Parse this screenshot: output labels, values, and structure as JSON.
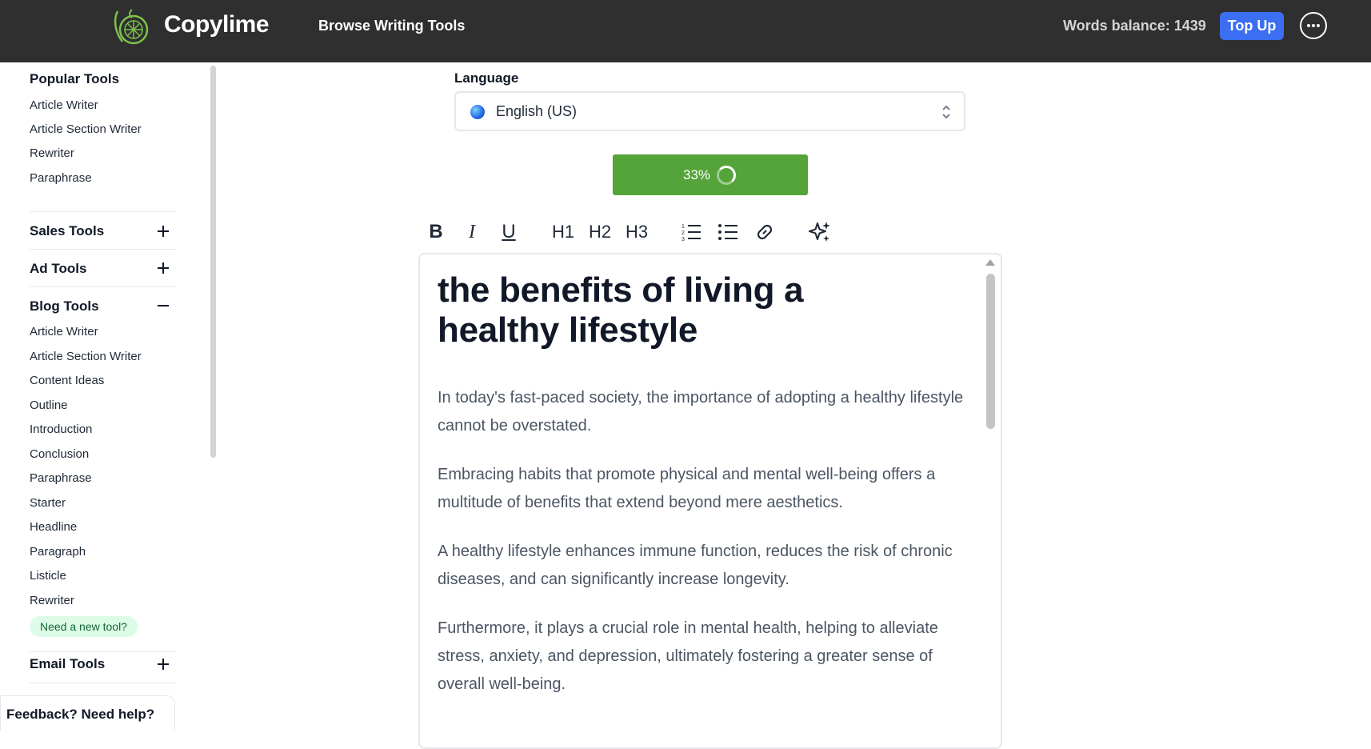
{
  "header": {
    "brand": "Copylime",
    "browse_label": "Browse Writing Tools",
    "balance_label": "Words balance: 1439",
    "topup_label": "Top Up"
  },
  "sidebar": {
    "popular": {
      "title": "Popular Tools",
      "items": [
        "Article Writer",
        "Article Section Writer",
        "Rewriter",
        "Paraphrase"
      ]
    },
    "sales_title": "Sales Tools",
    "ad_title": "Ad Tools",
    "blog": {
      "title": "Blog Tools",
      "items": [
        "Article Writer",
        "Article Section Writer",
        "Content Ideas",
        "Outline",
        "Introduction",
        "Conclusion",
        "Paraphrase",
        "Starter",
        "Headline",
        "Paragraph",
        "Listicle",
        "Rewriter"
      ]
    },
    "need_tool": "Need a new tool?",
    "email_title": "Email Tools",
    "feedback": "Feedback? Need help?"
  },
  "main": {
    "language_label": "Language",
    "language_value": "English (US)",
    "progress_text": "33%",
    "progress_percent": 33,
    "toolbar": {
      "bold": "B",
      "italic": "I",
      "underline": "U",
      "h1": "H1",
      "h2": "H2",
      "h3": "H3"
    },
    "editor": {
      "title": "the benefits of living a healthy lifestyle",
      "paragraphs": [
        "In today's fast-paced society, the importance of adopting a healthy lifestyle cannot be overstated.",
        "Embracing habits that promote physical and mental well-being offers a multitude of benefits that extend beyond mere aesthetics.",
        "A healthy lifestyle enhances immune function, reduces the risk of chronic diseases, and can significantly increase longevity.",
        "Furthermore, it plays a crucial role in mental health, helping to alleviate stress, anxiety, and depression, ultimately fostering a greater sense of overall well-being."
      ]
    }
  },
  "colors": {
    "topbar": "#2f2f2f",
    "accent_blue": "#3b6ef0",
    "progress_green": "#55a43a",
    "badge_green": "#dcfce7"
  }
}
